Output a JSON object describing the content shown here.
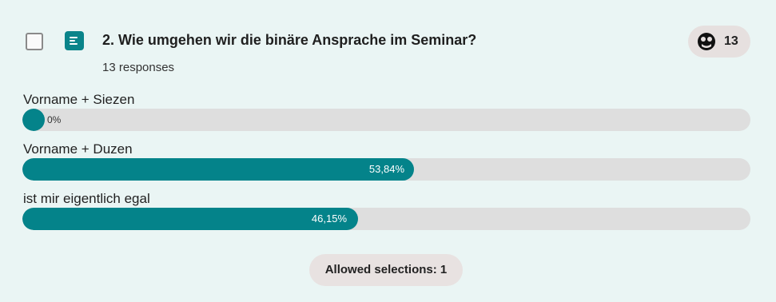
{
  "question": {
    "title": "2. Wie umgehen wir die binäre Ansprache im Seminar?",
    "responses_text": "13 responses",
    "response_count": "13",
    "icon": "text-list-icon",
    "count_icon": "users-face-icon"
  },
  "options": [
    {
      "label": "Vorname + Siezen",
      "percent_text": "0%",
      "percent": 0
    },
    {
      "label": "Vorname + Duzen",
      "percent_text": "53,84%",
      "percent": 53.84
    },
    {
      "label": "ist mir eigentlich egal",
      "percent_text": "46,15%",
      "percent": 46.15
    }
  ],
  "allowed_selections": "Allowed selections: 1",
  "colors": {
    "accent": "#04838a",
    "track": "#dedede",
    "background": "#eaf5f4"
  }
}
